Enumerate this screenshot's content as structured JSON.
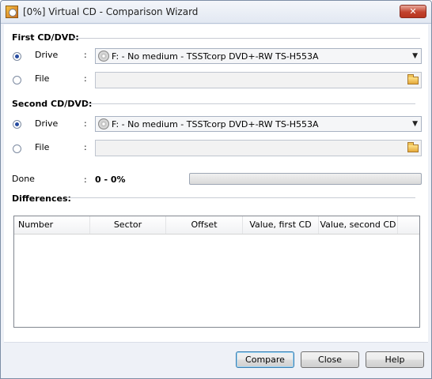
{
  "window": {
    "title": "[0%] Virtual CD - Comparison Wizard",
    "close_label": "✕"
  },
  "first": {
    "heading": "First CD/DVD:",
    "drive_label": "Drive",
    "file_label": "File",
    "colon": ":",
    "drive_value": "F: - No medium - TSSTcorp DVD+-RW TS-H553A",
    "selected": "drive"
  },
  "second": {
    "heading": "Second CD/DVD:",
    "drive_label": "Drive",
    "file_label": "File",
    "colon": ":",
    "drive_value": "F: - No medium - TSSTcorp DVD+-RW TS-H553A",
    "selected": "drive"
  },
  "progress": {
    "label": "Done",
    "colon": ":",
    "value_text": "0  - 0%",
    "fraction": 0
  },
  "differences": {
    "heading": "Differences:",
    "columns": [
      "Number",
      "Sector",
      "Offset",
      "Value, first CD",
      "Value, second CD"
    ],
    "rows": []
  },
  "buttons": {
    "compare": "Compare",
    "close": "Close",
    "help": "Help"
  }
}
